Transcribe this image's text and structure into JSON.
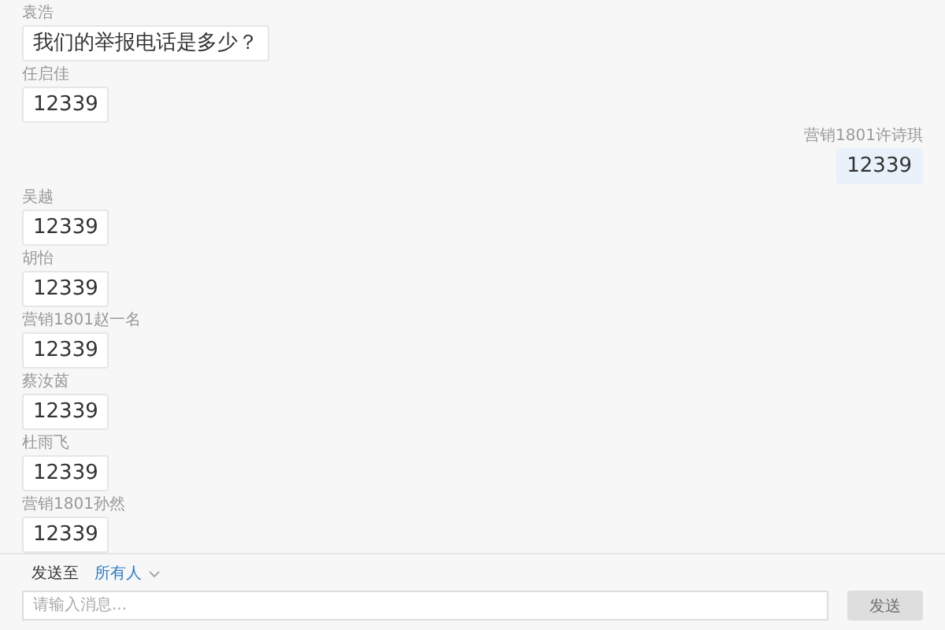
{
  "messages": [
    {
      "sender": "袁浩",
      "text": "我们的举报电话是多少？",
      "own": false
    },
    {
      "sender": "任启佳",
      "text": "12339",
      "own": false
    },
    {
      "sender": "营销1801许诗琪",
      "text": "12339",
      "own": true
    },
    {
      "sender": "吴越",
      "text": "12339",
      "own": false
    },
    {
      "sender": "胡怡",
      "text": "12339",
      "own": false
    },
    {
      "sender": "营销1801赵一名",
      "text": "12339",
      "own": false
    },
    {
      "sender": "蔡汝茵",
      "text": "12339",
      "own": false
    },
    {
      "sender": "杜雨飞",
      "text": "12339",
      "own": false
    },
    {
      "sender": "营销1801孙然",
      "text": "12339",
      "own": false
    }
  ],
  "composer": {
    "send_to_label": "发送至",
    "recipient": "所有人",
    "placeholder": "请输入消息...",
    "send_button": "发送",
    "send_disabled": true
  }
}
